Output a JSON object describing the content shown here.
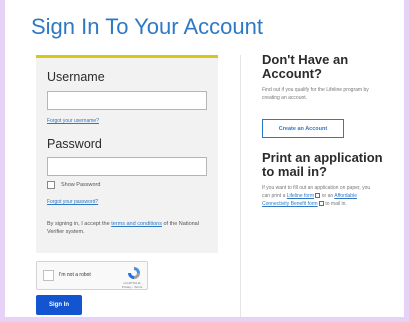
{
  "page_title": "Sign In To Your Account",
  "login": {
    "username_label": "Username",
    "username_value": "",
    "forgot_username": "Forgot your username?",
    "password_label": "Password",
    "password_value": "",
    "show_password": "Show Password",
    "forgot_password": "Forgot your password?",
    "terms_prefix": "By signing in, I accept the ",
    "terms_link": "terms and conditions",
    "terms_suffix": " of the National Verifier system."
  },
  "recaptcha": {
    "label": "I'm not a robot",
    "brand": "reCAPTCHA",
    "links": "Privacy - Terms"
  },
  "signin_button": "Sign In",
  "right": {
    "no_account_title": "Don't Have an Account?",
    "no_account_text": "Find out if you qualify for the Lifeline program by creating an account.",
    "create_button": "Create an Account",
    "print_title": "Print an application to mail in?",
    "print_text_1": "If you want to fill out an application on paper, you can print a ",
    "lifeline_form_link": "Lifeline form",
    "print_text_2": " or an ",
    "acp_form_link": "Affordable Connectivity Benefit form",
    "print_text_3": " to mail in."
  },
  "colors": {
    "brand_blue": "#2e79c7",
    "button_blue": "#1355d0",
    "accent_yellow": "#d4c81a",
    "frame_lavender": "#e6d2f7"
  }
}
